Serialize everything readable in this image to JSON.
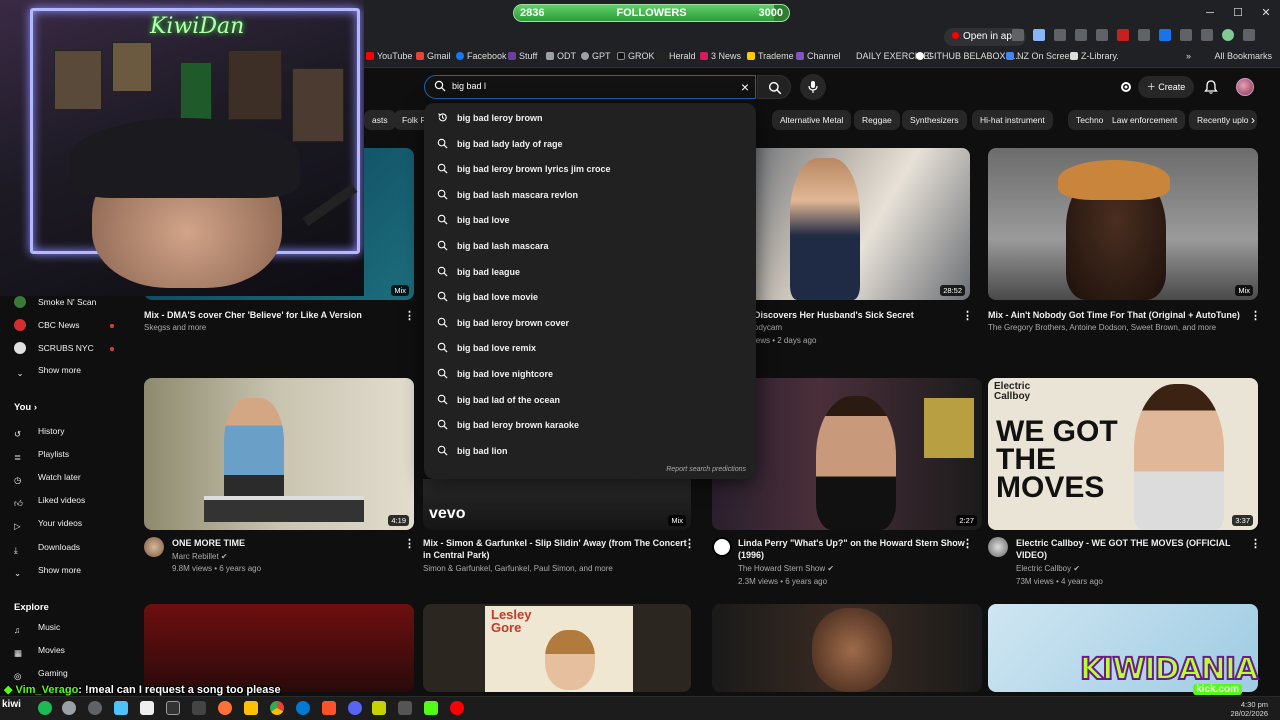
{
  "overlay": {
    "followers": {
      "label": "FOLLOWERS",
      "current": "2836",
      "goal": "3000",
      "progress": 0.9453
    },
    "chat": {
      "username": "Vim_Verago",
      "message": ": !meal can I request a song too please"
    },
    "logo_text": "KIWIDANIA",
    "logo_sub": "kick.com",
    "corner_text": "kiwi"
  },
  "browser": {
    "open_in_app": "Open in app",
    "bookmarks": [
      "YouTube",
      "Gmail",
      "Facebook",
      "Stuff",
      "ODT",
      "GPT",
      "GROK",
      "Herald",
      "3 News",
      "Trademe",
      "Channel",
      "DAILY EXERCISE!",
      "GITHUB BELABOX P...",
      "NZ On Screen",
      "Z-Library."
    ],
    "all_bookmarks": "All Bookmarks"
  },
  "header": {
    "search_value": "big bad l",
    "clear_icon": "×",
    "create_label": "Create"
  },
  "suggestions": [
    {
      "text": "big bad leroy brown",
      "icon": "history-icon"
    },
    {
      "text": "big bad lady lady of rage",
      "icon": "search-icon"
    },
    {
      "text": "big bad leroy brown lyrics jim croce",
      "icon": "search-icon"
    },
    {
      "text": "big bad lash mascara revlon",
      "icon": "search-icon"
    },
    {
      "text": "big bad love",
      "icon": "search-icon"
    },
    {
      "text": "big bad lash mascara",
      "icon": "search-icon"
    },
    {
      "text": "big bad league",
      "icon": "search-icon"
    },
    {
      "text": "big bad love movie",
      "icon": "search-icon"
    },
    {
      "text": "big bad leroy brown cover",
      "icon": "search-icon"
    },
    {
      "text": "big bad love remix",
      "icon": "search-icon"
    },
    {
      "text": "big bad love nightcore",
      "icon": "search-icon"
    },
    {
      "text": "big bad lad of the ocean",
      "icon": "search-icon"
    },
    {
      "text": "big bad leroy brown karaoke",
      "icon": "search-icon"
    },
    {
      "text": "big bad lion",
      "icon": "search-icon"
    }
  ],
  "report_text": "Report search predictions",
  "chips": [
    "asts",
    "Folk R",
    "Alternative Metal",
    "Reggae",
    "Synthesizers",
    "Hi-hat instrument",
    "Techno",
    "Law enforcement",
    "Recently uplo"
  ],
  "sidebar": {
    "subscriptions": [
      "Smoke N' Scan",
      "CBC News",
      "SCRUBS NYC"
    ],
    "show_more": "Show more",
    "you_heading": "You",
    "you_items": [
      "History",
      "Playlists",
      "Watch later",
      "Liked videos",
      "Your videos",
      "Downloads",
      "Show more"
    ],
    "explore_heading": "Explore",
    "explore_items": [
      "Music",
      "Movies",
      "Gaming"
    ]
  },
  "videos_row1": [
    {
      "title": "Mix - DMA'S cover Cher 'Believe' for Like A Version",
      "meta1": "Skegss and more",
      "meta2": "",
      "badge": "Mix"
    },
    {
      "title": "Discovers Her Husband's Sick Secret",
      "meta1": "odycam",
      "meta2": "iews • 2 days ago",
      "badge": "28:52"
    },
    {
      "title": "Mix - Ain't Nobody Got Time For That (Original + AutoTune)",
      "meta1": "The Gregory Brothers, Antoine Dodson, Sweet Brown, and more",
      "meta2": "",
      "badge": "Mix"
    }
  ],
  "videos_row2": [
    {
      "title": "ONE MORE TIME",
      "title2": "",
      "channel": "Marc Rebillet",
      "meta": "9.8M views • 6 years ago",
      "badge": "4:19"
    },
    {
      "title": "Mix - Simon & Garfunkel - Slip Slidin' Away (from The Concert",
      "title2": "in Central Park)",
      "channel": "Simon & Garfunkel, Garfunkel, Paul Simon, and more",
      "meta": "",
      "badge": "Mix",
      "logo": "vevo"
    },
    {
      "title": "Linda Perry \"What's Up?\" on the Howard Stern Show",
      "title2": "(1996)",
      "channel": "The Howard Stern Show",
      "meta": "2.3M views • 6 years ago",
      "badge": "2:27"
    },
    {
      "title": "Electric Callboy - WE GOT THE MOVES (OFFICIAL",
      "title2": "VIDEO)",
      "channel": "Electric Callboy",
      "meta": "73M views • 4 years ago",
      "badge": "3:37",
      "thumb_brand": "Electric Callboy",
      "thumb_text": "WE GOT THE MOVES"
    }
  ],
  "row3_album_text": "Lesley Gore",
  "webcam": {
    "sign": "KiwiDan"
  },
  "taskbar": {
    "time": "4:30 pm",
    "date": "28/02/2026"
  }
}
